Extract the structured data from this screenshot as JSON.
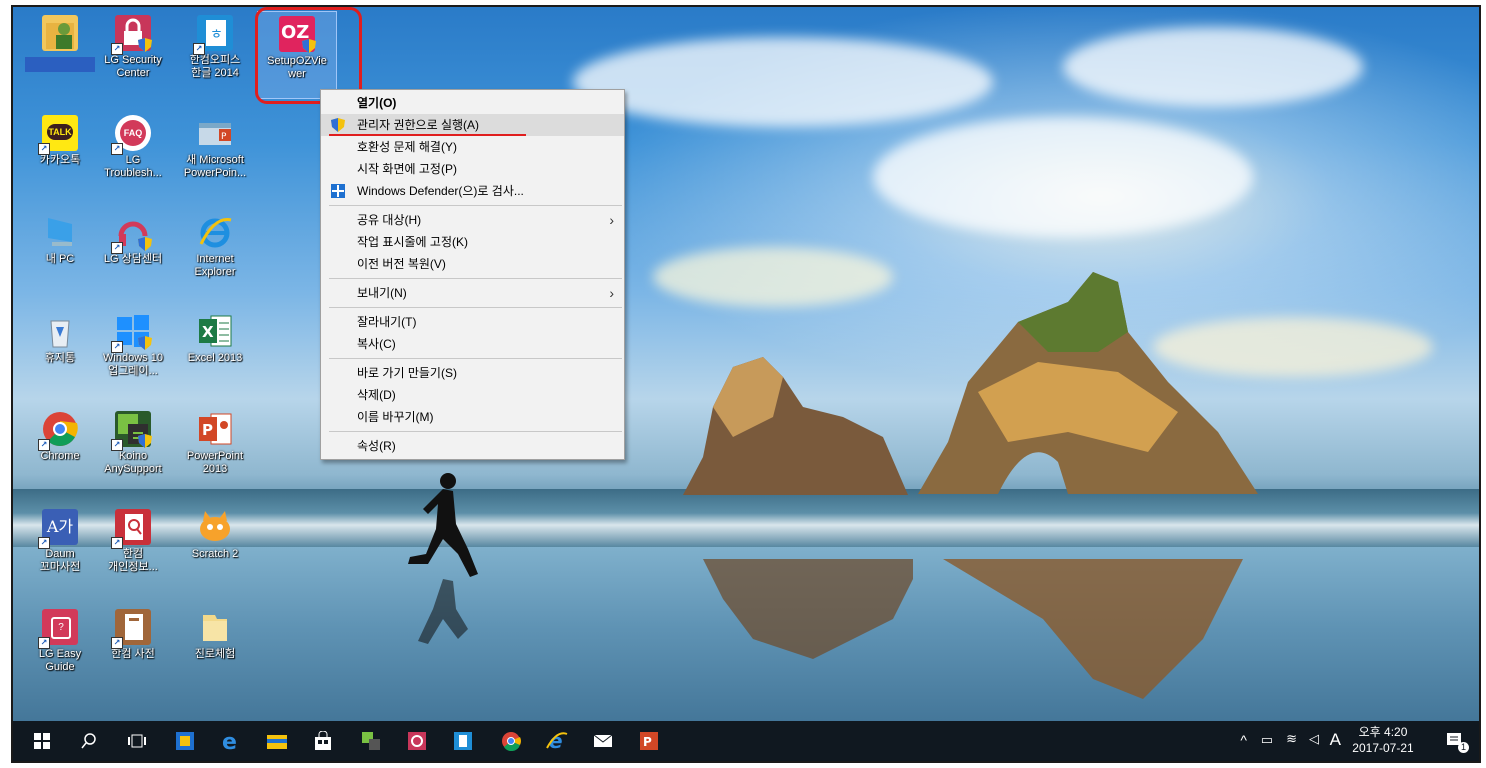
{
  "desktop": {
    "icons": [
      {
        "label": "",
        "name": "user-folder"
      },
      {
        "label": "LG Security\nCenter",
        "name": "lg-security-center"
      },
      {
        "label": "한컴오피스\n한글 2014",
        "name": "hancom-hangul-2014"
      },
      {
        "label": "SetupOZVie\nwer",
        "name": "setup-oz-viewer"
      },
      {
        "label": "카카오톡",
        "name": "kakaotalk"
      },
      {
        "label": "LG\nTroublesh...",
        "name": "lg-troubleshooting"
      },
      {
        "label": "새 Microsoft\nPowerPoin...",
        "name": "new-powerpoint"
      },
      {
        "label": "내 PC",
        "name": "this-pc"
      },
      {
        "label": "LG 상담센터",
        "name": "lg-support-center"
      },
      {
        "label": "Internet\nExplorer",
        "name": "internet-explorer"
      },
      {
        "label": "휴지통",
        "name": "recycle-bin"
      },
      {
        "label": "Windows 10\n업그레이...",
        "name": "windows10-upgrade"
      },
      {
        "label": "Excel 2013",
        "name": "excel-2013"
      },
      {
        "label": "Chrome",
        "name": "chrome"
      },
      {
        "label": "Koino\nAnySupport",
        "name": "koino-anysupport"
      },
      {
        "label": "PowerPoint\n2013",
        "name": "powerpoint-2013"
      },
      {
        "label": "Daum\n꼬마사전",
        "name": "daum-dictionary"
      },
      {
        "label": "한컴\n개인정보...",
        "name": "hancom-privacy"
      },
      {
        "label": "Scratch 2",
        "name": "scratch-2"
      },
      {
        "label": "LG Easy\nGuide",
        "name": "lg-easy-guide"
      },
      {
        "label": "한컴 사전",
        "name": "hancom-dictionary"
      },
      {
        "label": "진로체험",
        "name": "career-experience"
      }
    ]
  },
  "context_menu": {
    "items": [
      {
        "label": "열기(O)",
        "bold": true
      },
      {
        "label": "관리자 권한으로 실행(A)",
        "icon": "uac-shield-icon",
        "hover": true
      },
      {
        "label": "호환성 문제 해결(Y)"
      },
      {
        "label": "시작 화면에 고정(P)"
      },
      {
        "label": "Windows Defender(으)로 검사...",
        "icon": "defender-icon"
      },
      {
        "label": "공유 대상(H)",
        "submenu": true
      },
      {
        "label": "작업 표시줄에 고정(K)"
      },
      {
        "label": "이전 버전 복원(V)"
      },
      {
        "label": "보내기(N)",
        "submenu": true
      },
      {
        "label": "잘라내기(T)"
      },
      {
        "label": "복사(C)"
      },
      {
        "label": "바로 가기 만들기(S)"
      },
      {
        "label": "삭제(D)"
      },
      {
        "label": "이름 바꾸기(M)"
      },
      {
        "label": "속성(R)"
      }
    ]
  },
  "taskbar": {
    "clock_time": "오후 4:20",
    "clock_date": "2017-07-21",
    "ime": "A",
    "notification_count": "1"
  }
}
